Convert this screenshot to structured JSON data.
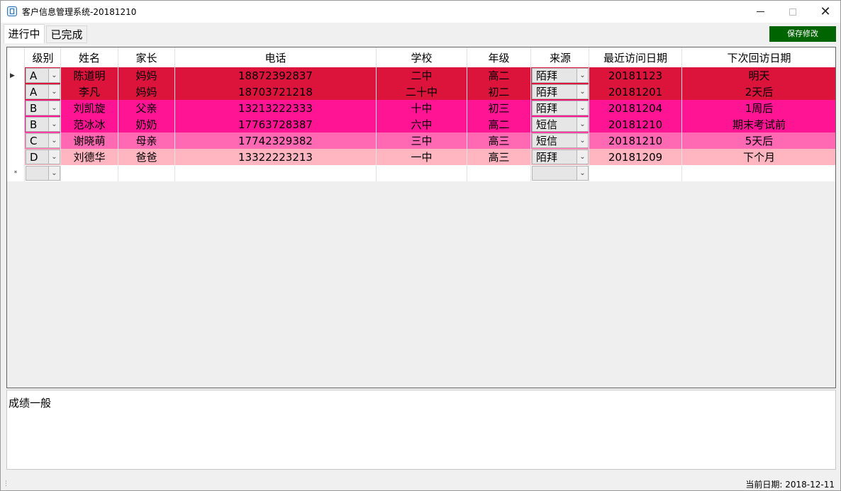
{
  "window": {
    "title": "客户信息管理系统-20181210"
  },
  "tabs": [
    {
      "label": "进行中"
    },
    {
      "label": "已完成"
    }
  ],
  "toolbar": {
    "save_label": "保存修改"
  },
  "grid": {
    "columns": [
      "级别",
      "姓名",
      "家长",
      "电话",
      "学校",
      "年级",
      "来源",
      "最近访问日期",
      "下次回访日期"
    ],
    "rows": [
      {
        "level": "A",
        "name": "陈道明",
        "parent": "妈妈",
        "phone": "18872392837",
        "school": "二中",
        "grade": "高二",
        "source": "陌拜",
        "last_visit": "20181123",
        "next_visit": "明天",
        "color": "#dc143c"
      },
      {
        "level": "A",
        "name": "李凡",
        "parent": "妈妈",
        "phone": "18703721218",
        "school": "二十中",
        "grade": "初二",
        "source": "陌拜",
        "last_visit": "20181201",
        "next_visit": "2天后",
        "color": "#dc143c"
      },
      {
        "level": "B",
        "name": "刘凯旋",
        "parent": "父亲",
        "phone": "13213222333",
        "school": "十中",
        "grade": "初三",
        "source": "陌拜",
        "last_visit": "20181204",
        "next_visit": "1周后",
        "color": "#ff1493"
      },
      {
        "level": "B",
        "name": "范冰冰",
        "parent": "奶奶",
        "phone": "17763728387",
        "school": "六中",
        "grade": "高二",
        "source": "短信",
        "last_visit": "20181210",
        "next_visit": "期末考试前",
        "color": "#ff1493"
      },
      {
        "level": "C",
        "name": "谢晓萌",
        "parent": "母亲",
        "phone": "17742329382",
        "school": "三中",
        "grade": "高三",
        "source": "短信",
        "last_visit": "20181210",
        "next_visit": "5天后",
        "color": "#ff69b4"
      },
      {
        "level": "D",
        "name": "刘德华",
        "parent": "爸爸",
        "phone": "13322223213",
        "school": "一中",
        "grade": "高三",
        "source": "陌拜",
        "last_visit": "20181209",
        "next_visit": "下个月",
        "color": "#ffb6c1"
      }
    ],
    "new_row_marker": "*",
    "current_row_marker": "▶"
  },
  "notes": {
    "text": "成绩一般"
  },
  "status": {
    "current_date": "当前日期: 2018-12-11"
  }
}
